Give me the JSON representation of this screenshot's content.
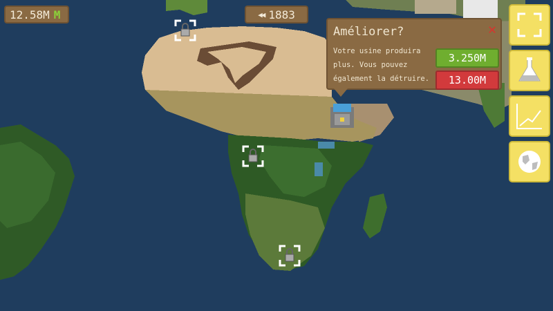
{
  "hud": {
    "money_value": "12.58M",
    "money_currency": "M",
    "year": "1883",
    "year_arrows": "◀◀"
  },
  "popup": {
    "title": "Améliorer?",
    "close": "✕",
    "description": "Votre usine produira plus. Vous pouvez également la détruire.",
    "upgrade_cost": "3.250M",
    "destroy_cost": "13.00M"
  },
  "sidebar": {
    "items": [
      {
        "icon": "fullscreen-icon"
      },
      {
        "icon": "flask-icon"
      },
      {
        "icon": "chart-icon"
      },
      {
        "icon": "globe-icon"
      }
    ]
  },
  "colors": {
    "ocean": "#1f3d5e",
    "panel": "#8a6a43",
    "sidebar_button": "#f4e064",
    "upgrade_button": "#6fae2f",
    "destroy_button": "#d23a3c",
    "money_letter": "#8bd33a"
  }
}
